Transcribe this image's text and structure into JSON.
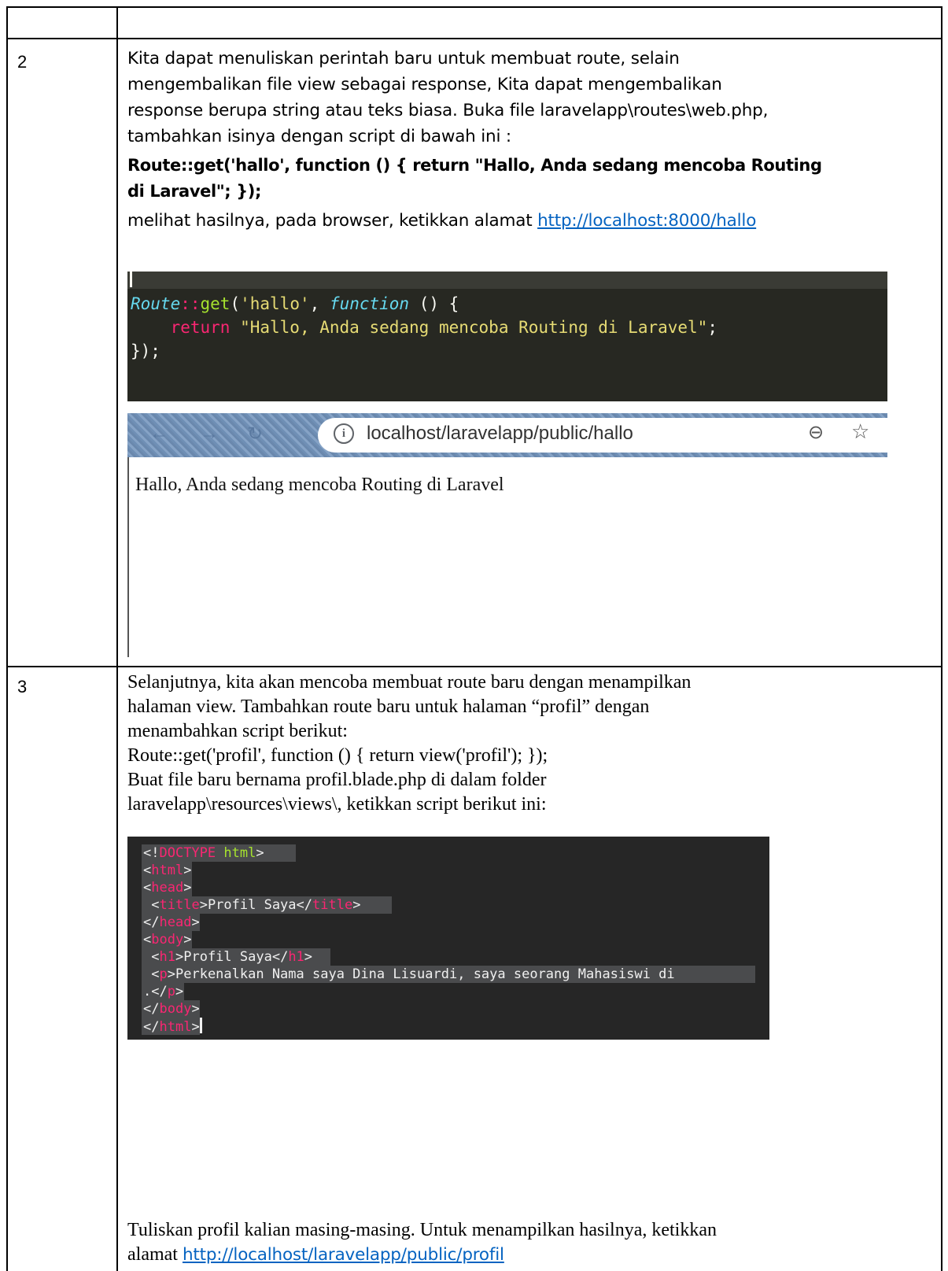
{
  "rows": [
    {
      "number": "2",
      "intro_lines": [
        "Kita dapat menuliskan perintah baru untuk membuat route, selain",
        "mengembalikan file view sebagai response, Kita dapat mengembalikan",
        "response berupa string atau teks biasa. Buka file laravelapp\\routes\\web.php,",
        "tambahkan isinya dengan script di bawah ini :"
      ],
      "bold_code_lines": [
        "Route::get('hallo', function () { return \"Hallo, Anda sedang mencoba Routing",
        "di Laravel\"; });"
      ],
      "result_prefix": "melihat hasilnya, pada browser, ketikkan alamat ",
      "result_link": "http://localhost:8000/hallo",
      "editor": {
        "line1": {
          "class": "Route",
          "op": "::",
          "fn": "get",
          "open": "(",
          "arg": "'hallo'",
          "sep": ", ",
          "kw": "function",
          "rest": " () {"
        },
        "line2": {
          "indent": "    ",
          "kw": "return",
          "str": "\"Hallo, Anda sedang mencoba Routing di Laravel\"",
          "end": ";"
        },
        "line3": "});"
      },
      "browser": {
        "url": "localhost/laravelapp/public/hallo",
        "page_text": "Hallo, Anda sedang mencoba Routing di Laravel",
        "icons": [
          "back-arrow-icon",
          "forward-arrow-icon",
          "reload-icon",
          "info-icon",
          "zoom-out-icon",
          "star-icon"
        ]
      }
    },
    {
      "number": "3",
      "intro_lines": [
        "Selanjutnya, kita akan mencoba membuat route baru dengan menampilkan",
        "halaman view. Tambahkan route baru untuk halaman “profil” dengan",
        "menambahkan script berikut:",
        "Route::get('profil', function () { return view('profil'); });",
        "Buat file baru bernama profil.blade.php di dalam folder",
        "laravelapp\\resources\\views\\, ketikkan script berikut ini:"
      ],
      "editor": {
        "doctype": {
          "open": "<!",
          "kw": "DOCTYPE",
          "attr": " html",
          "close": ">"
        },
        "lines": [
          {
            "open": "<",
            "tag": "html",
            "close": ">",
            "text": ""
          },
          {
            "open": "<",
            "tag": "head",
            "close": ">",
            "text": ""
          },
          {
            "indent": " ",
            "open": "<",
            "tag": "title",
            "close": ">",
            "text": "Profil Saya",
            "endopen": "</",
            "endtag": "title",
            "endclose": ">"
          },
          {
            "open": "</",
            "tag": "head",
            "close": ">",
            "text": ""
          },
          {
            "open": "<",
            "tag": "body",
            "close": ">",
            "text": ""
          },
          {
            "indent": " ",
            "open": "<",
            "tag": "h1",
            "close": ">",
            "text": "Profil Saya",
            "endopen": "</",
            "endtag": "h1",
            "endclose": ">"
          },
          {
            "indent": " ",
            "open": "<",
            "tag": "p",
            "close": ">",
            "text": "Perkenalkan Nama saya Dina Lisuardi, saya seorang Mahasiswi di"
          },
          {
            "pre": ".",
            "open": "</",
            "tag": "p",
            "close": ">",
            "text": ""
          },
          {
            "open": "</",
            "tag": "body",
            "close": ">",
            "text": ""
          },
          {
            "open": "</",
            "tag": "html",
            "close": ">",
            "text": ""
          }
        ]
      },
      "outro_line1": "Tuliskan profil kalian masing-masing. Untuk menampilkan hasilnya, ketikkan",
      "outro_prefix": "alamat ",
      "outro_link": "http://localhost/laravelapp/public/profil"
    }
  ]
}
